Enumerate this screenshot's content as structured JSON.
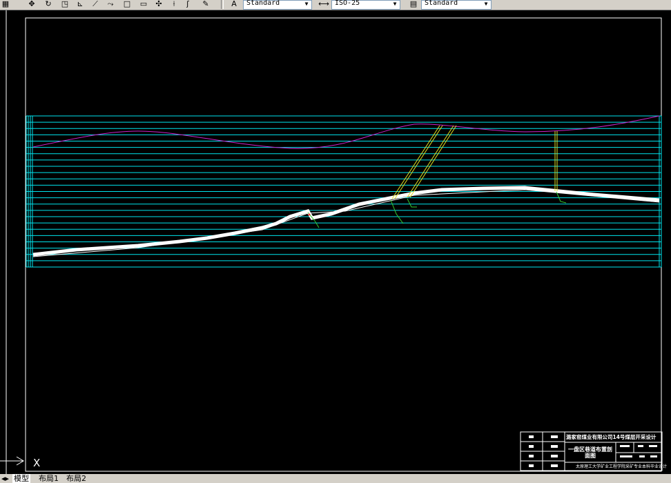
{
  "toolbar": {
    "text_style": "Standard",
    "dim_style": "ISO-25",
    "table_style": "Standard",
    "icons": [
      "grid-icon",
      "pan-icon",
      "rotate-icon",
      "zoom-window-icon",
      "measure-icon",
      "line-icon",
      "rectangle-icon",
      "move-icon",
      "trim-icon",
      "pen-icon"
    ]
  },
  "colors": {
    "background": "#000000",
    "frame": "#ffffff",
    "grid": "#00e5ee",
    "terrain": "#cc22cc",
    "seam": "#ffffff",
    "shaft": "#e0e020",
    "marker": "#33cc33"
  },
  "title_block": {
    "company": "潞家窑煤业有限公司14号煤层开采设计",
    "drawing_name": "一盘区巷道布置剖面图",
    "bottom_note": "太原理工大学矿业工程学院采矿专业本科毕业设计"
  },
  "tabs": [
    "模型",
    "布局1",
    "布局2"
  ],
  "ucs": {
    "x_label": "X"
  }
}
